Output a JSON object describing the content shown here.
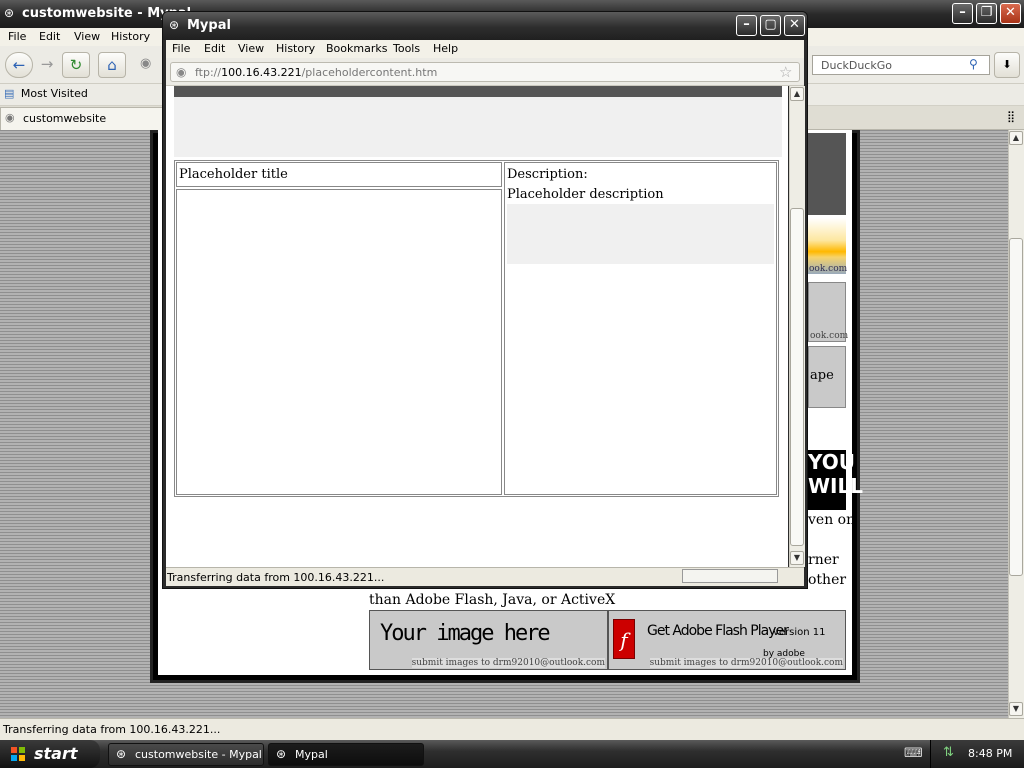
{
  "back_window": {
    "title": "customwebsite - Mypal",
    "menu": [
      "File",
      "Edit",
      "View",
      "History"
    ],
    "search_placeholder": "DuckDuckGo",
    "bookmarks": {
      "most_visited": "Most Visited"
    },
    "tab_label": "customwebsite",
    "status_text": "Transferring data from 100.16.43.221...",
    "page": {
      "ape_fragment": "ape",
      "you_will": "YOU WILL",
      "seen_on": "ven on",
      "corner": "rner",
      "other": "other",
      "flash_line": "than Adobe Flash, Java, or ActiveX",
      "ad_left_text": "Your image here",
      "ad_submit": "submit images to drm92010@outlook.com",
      "ad_right_text": "Get Adobe Flash Player",
      "ad_right_version": "version 11",
      "ad_right_by": "by adobe",
      "ook_com": "ook.com"
    }
  },
  "popup": {
    "title": "Mypal",
    "menu": [
      "File",
      "Edit",
      "View",
      "History",
      "Bookmarks",
      "Tools",
      "Help"
    ],
    "url_scheme": "ftp://",
    "url_host": "100.16.43.221",
    "url_path": "/placeholdercontent.htm",
    "content": {
      "title": "Placeholder title",
      "description_label": "Description:",
      "description": "Placeholder description"
    },
    "status_text": "Transferring data from 100.16.43.221..."
  },
  "taskbar": {
    "start_label": "start",
    "buttons": [
      "customwebsite - Mypal",
      "Mypal"
    ],
    "clock": "8:48 PM"
  }
}
